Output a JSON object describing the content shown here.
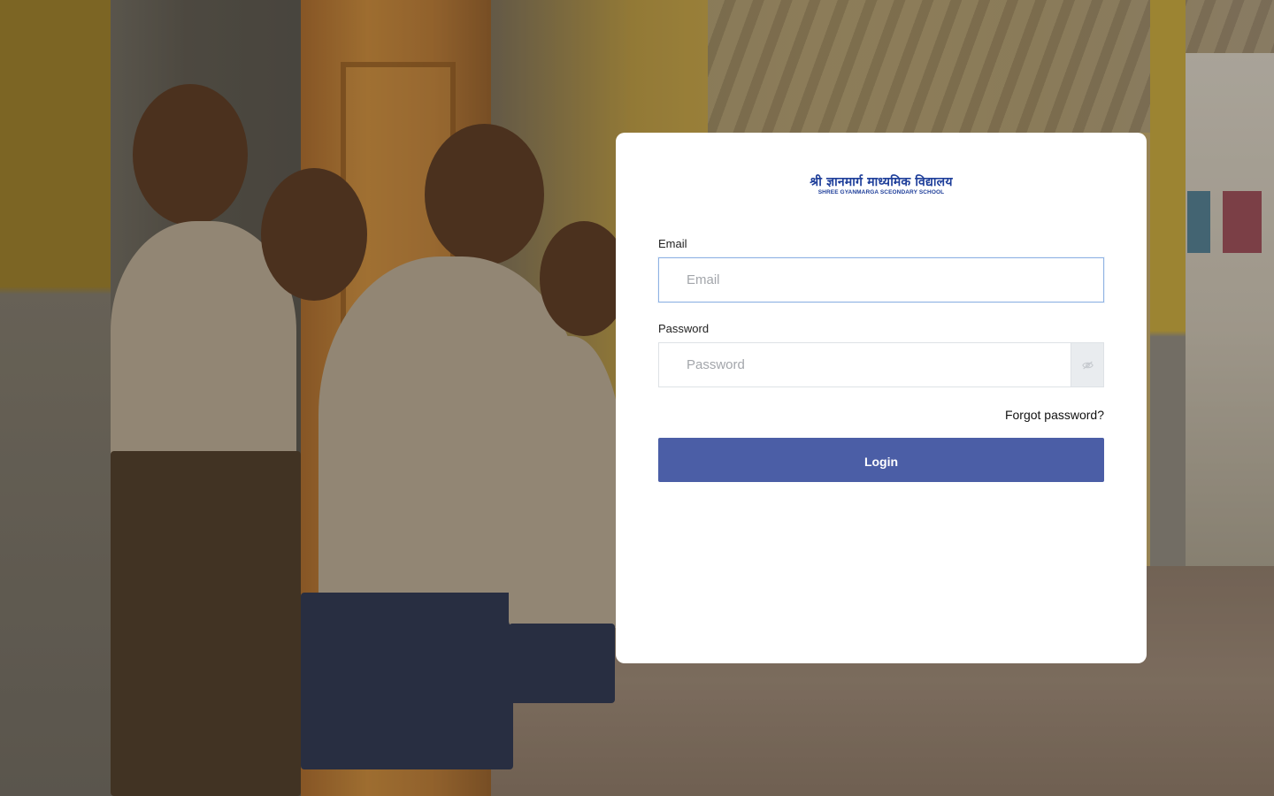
{
  "background": {
    "image": "school-children-photo"
  },
  "logo": {
    "title": "श्री ज्ञानमार्ग माध्यमिक विद्यालय",
    "subtitle": "SHREE GYANMARGA SCEONDARY SCHOOL"
  },
  "form": {
    "email_label": "Email",
    "email_placeholder": "Email",
    "email_value": "",
    "password_label": "Password",
    "password_placeholder": "Password",
    "password_value": "",
    "password_toggle_icon": "eye-slash-icon",
    "forgot_label": "Forgot password?",
    "login_label": "Login"
  },
  "colors": {
    "primary": "#4b5ea6",
    "logo": "#1f3f9a",
    "focus_border": "#8fb2e3"
  }
}
